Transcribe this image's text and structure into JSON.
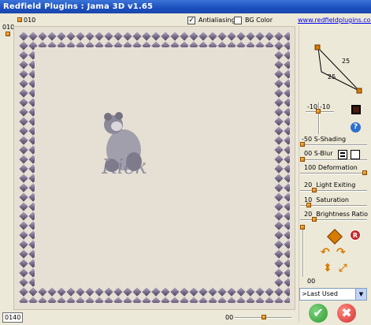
{
  "window": {
    "title": "Redfield Plugins : Jama 3D  v1.65"
  },
  "top": {
    "left_value": "010",
    "ruler_value": "010",
    "antialiasing_label": "Antialiasing",
    "antialiasing_checked": true,
    "bg_color_label": "BG Color",
    "bg_color_checked": false,
    "website": "www.redfieldplugins.com"
  },
  "perspective": {
    "value_top": "25",
    "value_left": "25"
  },
  "light_pos": {
    "x_value": "-10",
    "y_value": "-10"
  },
  "controls": {
    "s_shading": {
      "value": "-50",
      "label": "S-Shading"
    },
    "s_blur": {
      "value": "00",
      "label": "S-Blur"
    },
    "deformation": {
      "value": "100",
      "label": "Deformation"
    },
    "light_exiting": {
      "value": "20",
      "label": "Light Exiting"
    },
    "saturation": {
      "value": "10",
      "label": "Saturation"
    },
    "brightness_ratio": {
      "value": "20",
      "label": "Brightness Ratio"
    },
    "vertical_value": "00"
  },
  "preset": {
    "selected": ">Last Used"
  },
  "bottom": {
    "left_value": "0140",
    "zoom_value": "00"
  },
  "watermark_text": "Rick",
  "colors": {
    "title_bar": "#2a5fcc",
    "frame_tile": "#7a6f8c",
    "ok": "#2f9a2f",
    "cancel": "#d32f2f",
    "accent": "#d77a00"
  },
  "icons": {
    "ok": "checkmark-icon",
    "cancel": "x-icon",
    "help": "question-icon",
    "reset": "r-icon"
  }
}
